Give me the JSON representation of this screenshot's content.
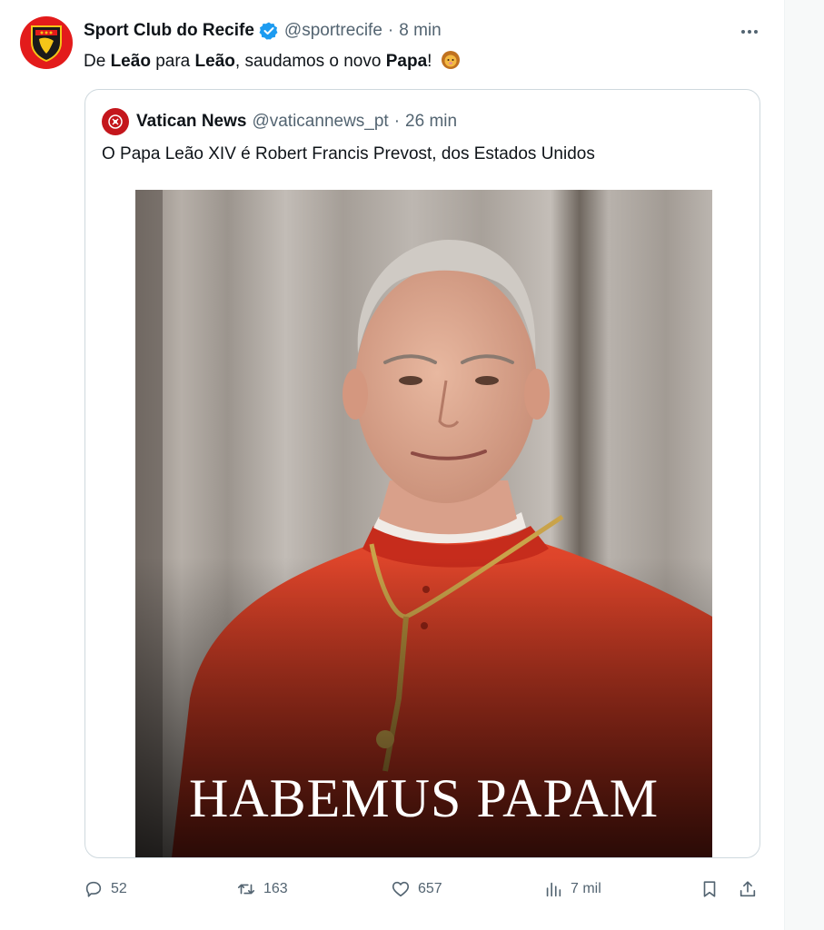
{
  "tweet": {
    "author_name": "Sport Club do Recife",
    "handle": "@sportrecife",
    "separator": "·",
    "time": "8 min",
    "more_icon": "more-horizontal-icon",
    "text_parts": [
      "De ",
      "Leão",
      " para ",
      "Leão",
      ", saudamos o novo ",
      "Papa",
      "!"
    ]
  },
  "quoted": {
    "author_name": "Vatican News",
    "handle": "@vaticannews_pt",
    "separator": "·",
    "time": "26 min",
    "text": "O Papa Leão XIV é Robert Francis Prevost, dos Estados Unidos",
    "image_caption": "HABEMUS PAPAM"
  },
  "actions": {
    "replies": "52",
    "retweets": "163",
    "likes": "657",
    "views": "7 mil"
  },
  "colors": {
    "accent": "#1d9bf0",
    "secondary_text": "#536471",
    "border": "#cfd9de",
    "club_red": "#e31b1b"
  }
}
